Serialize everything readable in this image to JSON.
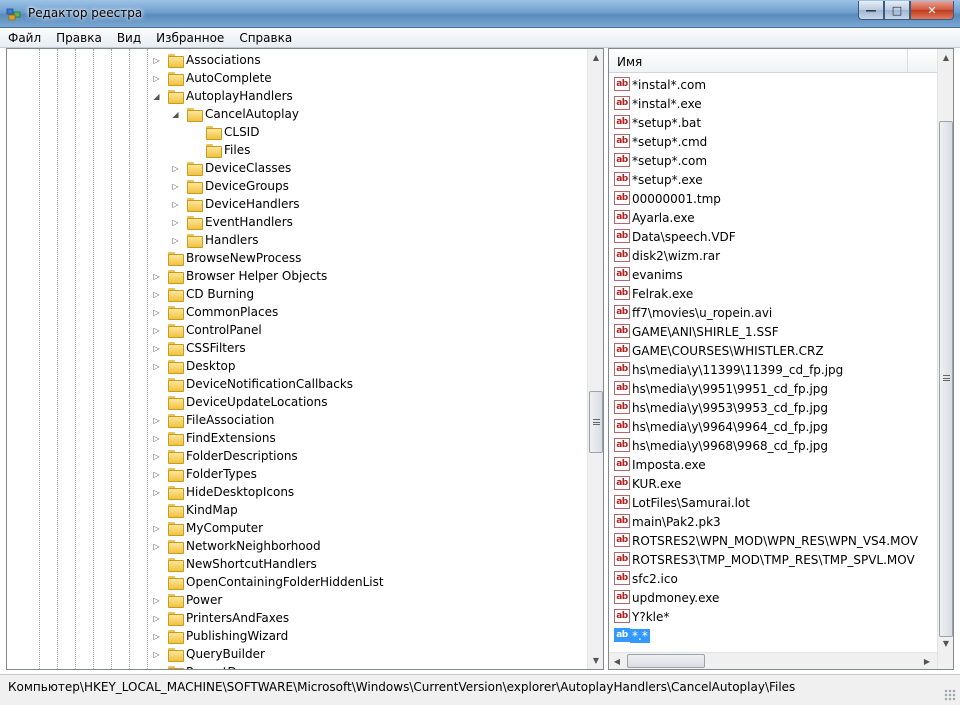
{
  "window": {
    "title": "Редактор реестра",
    "buttons": {
      "minimize": "—",
      "maximize": "□",
      "close": "✕"
    }
  },
  "menu": [
    {
      "label": "Файл"
    },
    {
      "label": "Правка"
    },
    {
      "label": "Вид"
    },
    {
      "label": "Избранное"
    },
    {
      "label": "Справка"
    }
  ],
  "tree": {
    "items": [
      {
        "label": "Associations",
        "level": 0,
        "expander": "▷"
      },
      {
        "label": "AutoComplete",
        "level": 0,
        "expander": "▷"
      },
      {
        "label": "AutoplayHandlers",
        "level": 0,
        "expander": "◢"
      },
      {
        "label": "CancelAutoplay",
        "level": 1,
        "expander": "◢"
      },
      {
        "label": "CLSID",
        "level": 2,
        "expander": ""
      },
      {
        "label": "Files",
        "level": 2,
        "expander": ""
      },
      {
        "label": "DeviceClasses",
        "level": 1,
        "expander": "▷"
      },
      {
        "label": "DeviceGroups",
        "level": 1,
        "expander": "▷"
      },
      {
        "label": "DeviceHandlers",
        "level": 1,
        "expander": "▷"
      },
      {
        "label": "EventHandlers",
        "level": 1,
        "expander": "▷"
      },
      {
        "label": "Handlers",
        "level": 1,
        "expander": "▷"
      },
      {
        "label": "BrowseNewProcess",
        "level": 0,
        "expander": ""
      },
      {
        "label": "Browser Helper Objects",
        "level": 0,
        "expander": "▷"
      },
      {
        "label": "CD Burning",
        "level": 0,
        "expander": "▷"
      },
      {
        "label": "CommonPlaces",
        "level": 0,
        "expander": "▷"
      },
      {
        "label": "ControlPanel",
        "level": 0,
        "expander": "▷"
      },
      {
        "label": "CSSFilters",
        "level": 0,
        "expander": "▷"
      },
      {
        "label": "Desktop",
        "level": 0,
        "expander": "▷"
      },
      {
        "label": "DeviceNotificationCallbacks",
        "level": 0,
        "expander": ""
      },
      {
        "label": "DeviceUpdateLocations",
        "level": 0,
        "expander": ""
      },
      {
        "label": "FileAssociation",
        "level": 0,
        "expander": "▷"
      },
      {
        "label": "FindExtensions",
        "level": 0,
        "expander": "▷"
      },
      {
        "label": "FolderDescriptions",
        "level": 0,
        "expander": "▷"
      },
      {
        "label": "FolderTypes",
        "level": 0,
        "expander": "▷"
      },
      {
        "label": "HideDesktopIcons",
        "level": 0,
        "expander": "▷"
      },
      {
        "label": "KindMap",
        "level": 0,
        "expander": ""
      },
      {
        "label": "MyComputer",
        "level": 0,
        "expander": "▷"
      },
      {
        "label": "NetworkNeighborhood",
        "level": 0,
        "expander": "▷"
      },
      {
        "label": "NewShortcutHandlers",
        "level": 0,
        "expander": ""
      },
      {
        "label": "OpenContainingFolderHiddenList",
        "level": 0,
        "expander": ""
      },
      {
        "label": "Power",
        "level": 0,
        "expander": "▷"
      },
      {
        "label": "PrintersAndFaxes",
        "level": 0,
        "expander": "▷"
      },
      {
        "label": "PublishingWizard",
        "level": 0,
        "expander": "▷"
      },
      {
        "label": "QueryBuilder",
        "level": 0,
        "expander": "▷"
      },
      {
        "label": "RecentDocs",
        "level": 0,
        "expander": "▷"
      }
    ]
  },
  "values_list": {
    "column_name": "Имя",
    "icon_text": "ab",
    "items": [
      "*instal*.com",
      "*instal*.exe",
      "*setup*.bat",
      "*setup*.cmd",
      "*setup*.com",
      "*setup*.exe",
      "00000001.tmp",
      "Ayarla.exe",
      "Data\\speech.VDF",
      "disk2\\wizm.rar",
      "evanims",
      "Felrak.exe",
      "ff7\\movies\\u_ropein.avi",
      "GAME\\ANI\\SHIRLE_1.SSF",
      "GAME\\COURSES\\WHISTLER.CRZ",
      "hs\\media\\y\\11399\\11399_cd_fp.jpg",
      "hs\\media\\y\\9951\\9951_cd_fp.jpg",
      "hs\\media\\y\\9953\\9953_cd_fp.jpg",
      "hs\\media\\y\\9964\\9964_cd_fp.jpg",
      "hs\\media\\y\\9968\\9968_cd_fp.jpg",
      "Imposta.exe",
      "KUR.exe",
      "LotFiles\\Samurai.lot",
      "main\\Pak2.pk3",
      "ROTSRES2\\WPN_MOD\\WPN_RES\\WPN_VS4.MOV",
      "ROTSRES3\\TMP_MOD\\TMP_RES\\TMP_SPVL.MOV",
      "sfc2.ico",
      "updmoney.exe",
      "Y?kle*",
      "*.*"
    ],
    "selected_index": 29
  },
  "statusbar": {
    "path": "Компьютер\\HKEY_LOCAL_MACHINE\\SOFTWARE\\Microsoft\\Windows\\CurrentVersion\\explorer\\AutoplayHandlers\\CancelAutoplay\\Files"
  },
  "scroll_arrows": {
    "up": "▲",
    "down": "▼",
    "left": "◀",
    "right": "▶"
  }
}
